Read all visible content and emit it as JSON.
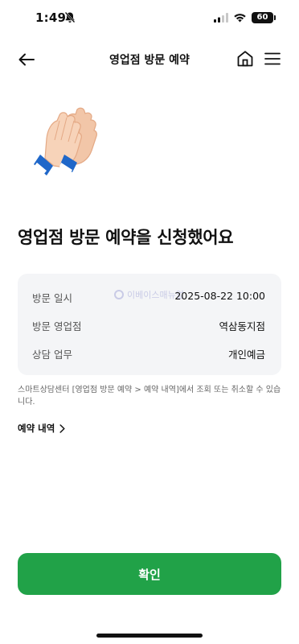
{
  "status_bar": {
    "time": "1:49",
    "battery": "60"
  },
  "header": {
    "title": "영업점 방문 예약"
  },
  "headline": "영업점 방문 예약을 신청했어요",
  "watermark": "이베이스매뉴얼",
  "info": [
    {
      "label": "방문 일시",
      "value": "2025-08-22 10:00"
    },
    {
      "label": "방문 영업점",
      "value": "역삼동지점"
    },
    {
      "label": "상담 업무",
      "value": "개인예금"
    }
  ],
  "notice": "스마트상담센터 [영업점 방문 예약 > 예약 내역]에서 조회 또는 취소할 수 있습니다.",
  "history_link": "예약 내역",
  "confirm_label": "확인",
  "colors": {
    "primary": "#21a248",
    "card_bg": "#f4f5f7"
  }
}
